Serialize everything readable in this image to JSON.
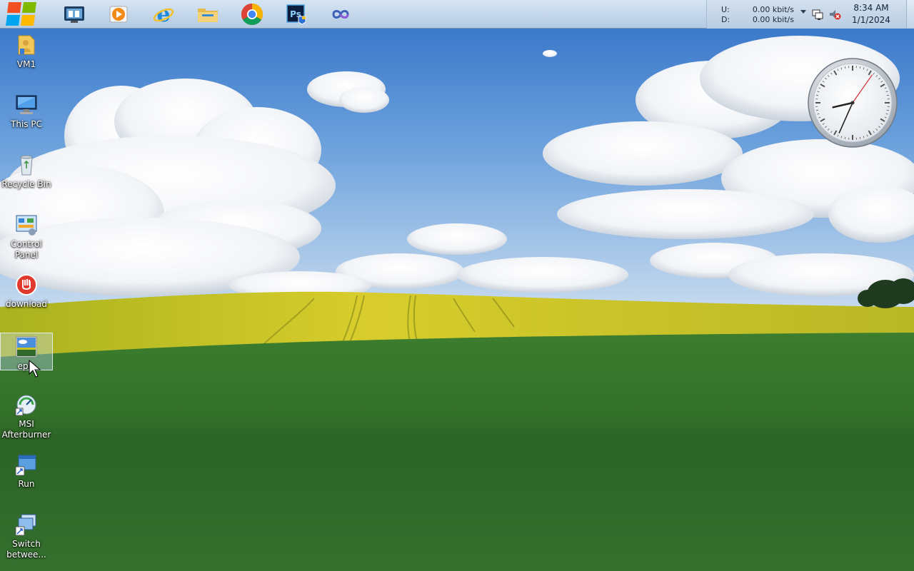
{
  "taskbar": {
    "start_label": "Start",
    "pinned": [
      {
        "name": "Server Manager"
      },
      {
        "name": "Windows Media Player"
      },
      {
        "name": "Internet Explorer"
      },
      {
        "name": "File Explorer"
      },
      {
        "name": "Google Chrome"
      },
      {
        "name": "Adobe Photoshop"
      },
      {
        "name": "Remote Desktop"
      }
    ],
    "tray": {
      "upload_label": "U:",
      "download_label": "D:",
      "upload_value": "0.00 kbit/s",
      "download_value": "0.00 kbit/s",
      "time": "8:34 AM",
      "date": "1/1/2024"
    }
  },
  "desktop": {
    "icons": [
      {
        "label": "VM1",
        "icon": "user-folder-icon"
      },
      {
        "label": "This PC",
        "icon": "computer-icon"
      },
      {
        "label": "Recycle Bin",
        "icon": "recycle-bin-icon"
      },
      {
        "label": "Control Panel",
        "icon": "control-panel-icon"
      },
      {
        "label": "download",
        "icon": "download-app-icon"
      },
      {
        "label": "epic",
        "icon": "image-file-icon",
        "selected": true
      },
      {
        "label": "MSI Afterburner",
        "icon": "msi-afterburner-icon"
      },
      {
        "label": "Run",
        "icon": "run-shortcut-icon"
      },
      {
        "label": "Switch betwee...",
        "icon": "switch-windows-icon"
      }
    ]
  },
  "gadget": {
    "type": "analog-clock",
    "hour": 8,
    "minute": 34
  },
  "colors": {
    "taskbar": "#c3d6ea",
    "sky": "#3f7fd0",
    "field_yellow": "#c9c226",
    "grass": "#2d6a2a"
  }
}
